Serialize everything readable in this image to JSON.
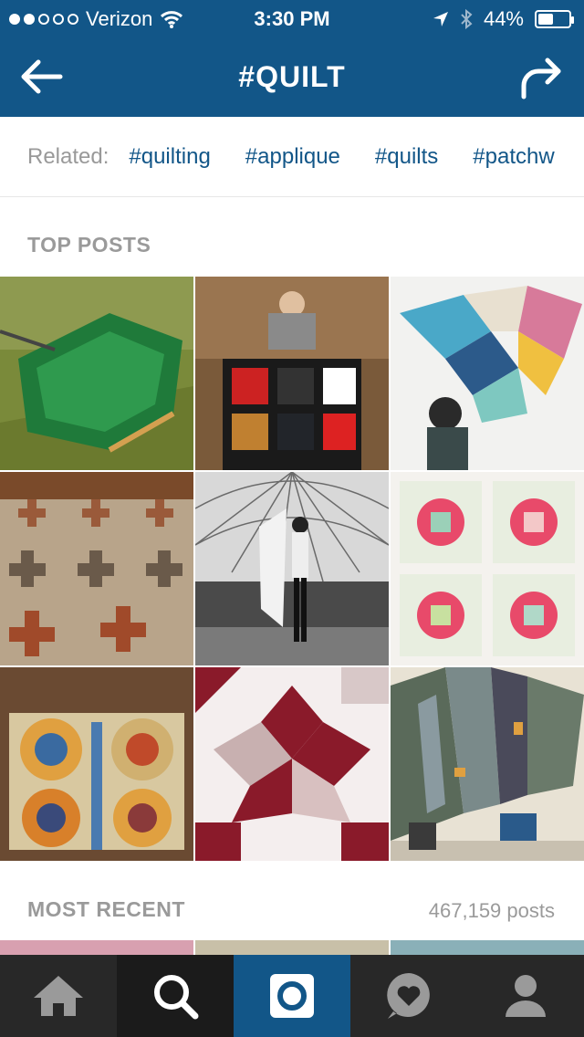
{
  "status_bar": {
    "carrier": "Verizon",
    "time": "3:30 PM",
    "battery": "44%",
    "battery_level": 0.44,
    "signal_dots_filled": 2,
    "signal_dots_total": 5
  },
  "nav": {
    "title": "#QUILT",
    "back_icon": "back-arrow-icon",
    "share_icon": "share-arrow-icon"
  },
  "related": {
    "label": "Related:",
    "tags": [
      "#quilting",
      "#applique",
      "#quilts",
      "#patchw"
    ]
  },
  "sections": {
    "top_posts": "TOP POSTS",
    "most_recent": "MOST RECENT",
    "posts_count": "467,159 posts"
  },
  "tabbar": {
    "items": [
      "home-icon",
      "search-icon",
      "camera-icon",
      "activity-heart-icon",
      "profile-icon"
    ],
    "active": "search-icon"
  },
  "colors": {
    "brand": "#125688",
    "tabbar": "#282828",
    "tag_text": "#125688",
    "muted": "#9a9a9a"
  }
}
